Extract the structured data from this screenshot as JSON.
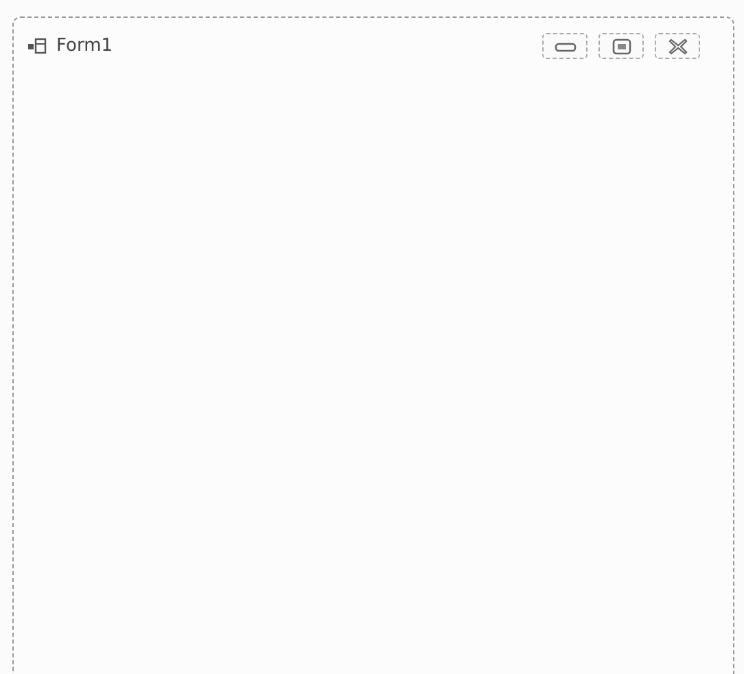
{
  "window": {
    "title": "Form1"
  }
}
